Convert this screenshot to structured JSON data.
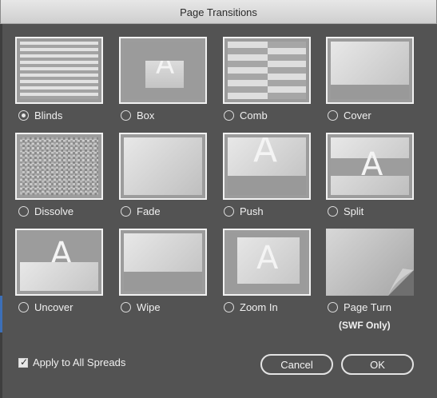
{
  "window": {
    "title": "Page Transitions"
  },
  "transitions": [
    {
      "id": "blinds",
      "label": "Blinds",
      "selected": true
    },
    {
      "id": "box",
      "label": "Box",
      "selected": false
    },
    {
      "id": "comb",
      "label": "Comb",
      "selected": false
    },
    {
      "id": "cover",
      "label": "Cover",
      "selected": false
    },
    {
      "id": "dissolve",
      "label": "Dissolve",
      "selected": false
    },
    {
      "id": "fade",
      "label": "Fade",
      "selected": false
    },
    {
      "id": "push",
      "label": "Push",
      "selected": false
    },
    {
      "id": "split",
      "label": "Split",
      "selected": false
    },
    {
      "id": "uncover",
      "label": "Uncover",
      "selected": false
    },
    {
      "id": "wipe",
      "label": "Wipe",
      "selected": false
    },
    {
      "id": "zoom-in",
      "label": "Zoom In",
      "selected": false
    },
    {
      "id": "page-turn",
      "label": "Page Turn",
      "note": "(SWF Only)",
      "selected": false
    }
  ],
  "thumb_letter": "A",
  "apply_all": {
    "label": "Apply to All Spreads",
    "checked": true
  },
  "buttons": {
    "cancel": "Cancel",
    "ok": "OK"
  }
}
